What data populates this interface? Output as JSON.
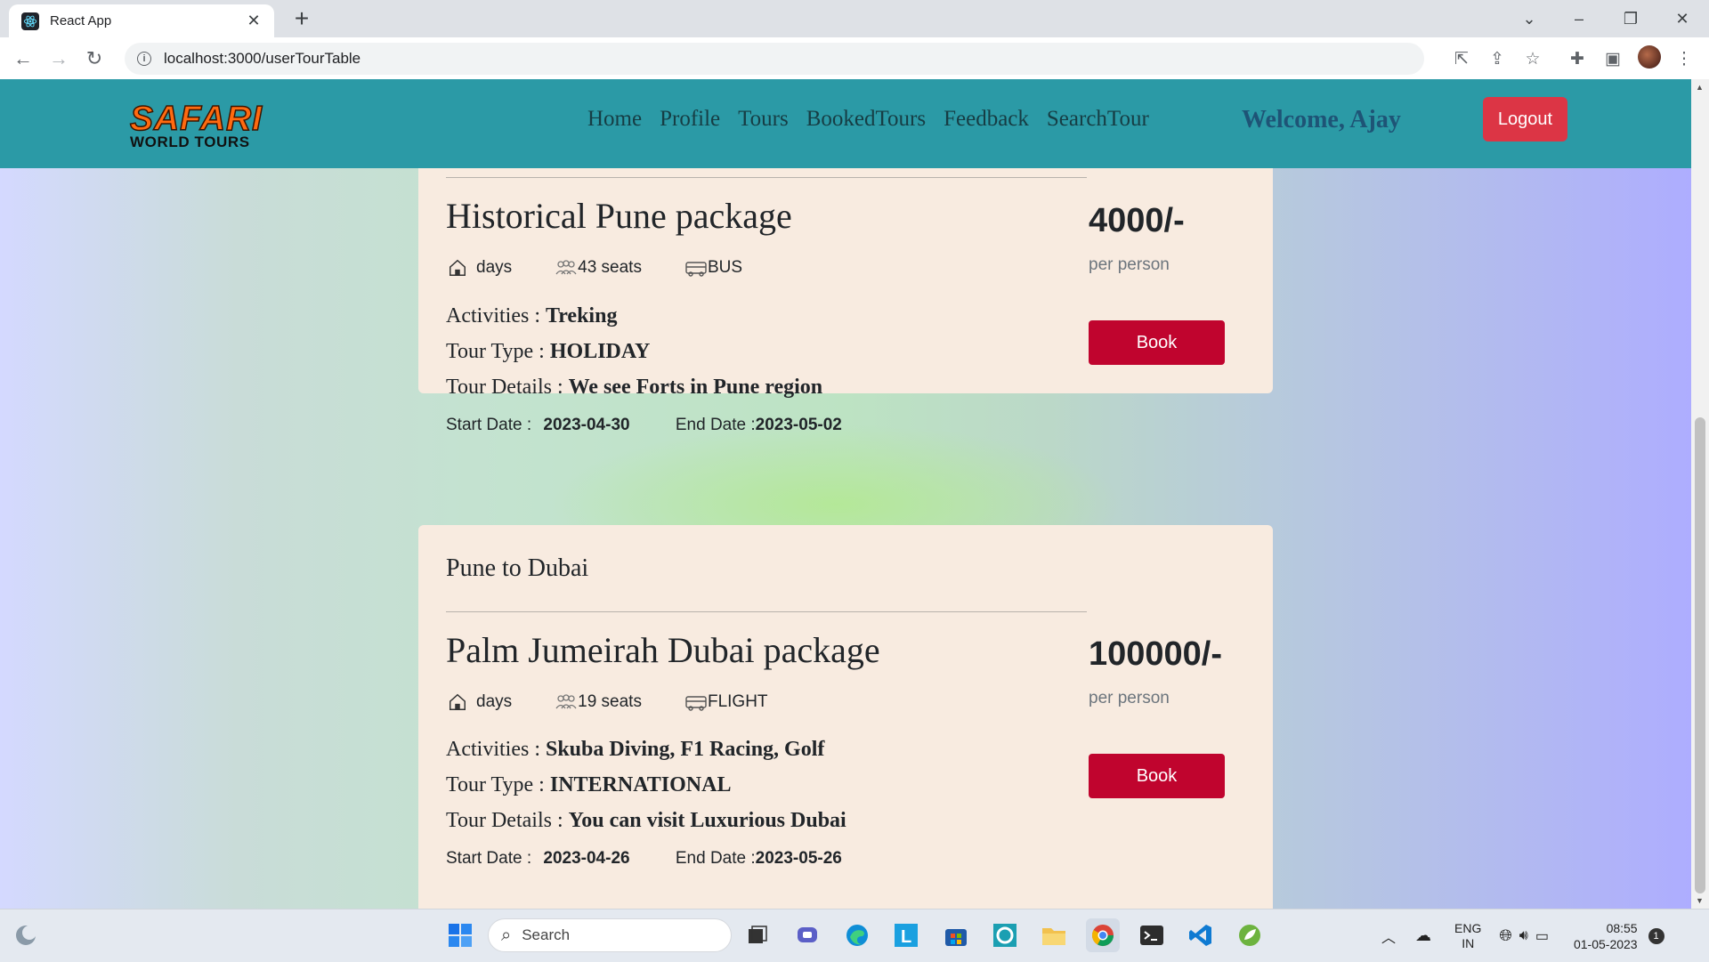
{
  "browser": {
    "tab_title": "React App",
    "url": "localhost:3000/userTourTable"
  },
  "navbar": {
    "logo_line1": "SAFARI",
    "logo_line2": "WORLD TOURS",
    "links": [
      "Home",
      "Profile",
      "Tours",
      "BookedTours",
      "Feedback",
      "SearchTour"
    ],
    "welcome": "Welcome, Ajay",
    "logout_label": "Logout"
  },
  "tours": [
    {
      "from_to": "",
      "name": "Historical Pune package",
      "days_label": "days",
      "seats": "43 seats",
      "transport": "BUS",
      "activities_label": "Activities :",
      "activities": "Treking",
      "type_label": "Tour Type :",
      "type": "HOLIDAY",
      "details_label": "Tour Details :",
      "details": "We see Forts in Pune region",
      "start_label": "Start Date :",
      "start_date": "2023-04-30",
      "end_label": "End Date :",
      "end_date": "2023-05-02",
      "price": "4000/-",
      "per_person": "per person",
      "book_label": "Book"
    },
    {
      "from_to": "Pune to Dubai",
      "name": "Palm Jumeirah Dubai package",
      "days_label": "days",
      "seats": "19 seats",
      "transport": "FLIGHT",
      "activities_label": "Activities :",
      "activities": "Skuba Diving, F1 Racing, Golf",
      "type_label": "Tour Type :",
      "type": "INTERNATIONAL",
      "details_label": "Tour Details :",
      "details": "You can visit Luxurious Dubai",
      "start_label": "Start Date :",
      "start_date": "2023-04-26",
      "end_label": "End Date :",
      "end_date": "2023-05-26",
      "price": "100000/-",
      "per_person": "per person",
      "book_label": "Book"
    }
  ],
  "taskbar": {
    "search_placeholder": "Search",
    "lang_line1": "ENG",
    "lang_line2": "IN",
    "time": "08:55",
    "date": "01-05-2023",
    "notification_count": "1"
  },
  "colors": {
    "navbar": "#2b9aa6",
    "card": "#f8ebe0",
    "book_button": "#c0042e",
    "logout_button": "#dc3545"
  }
}
